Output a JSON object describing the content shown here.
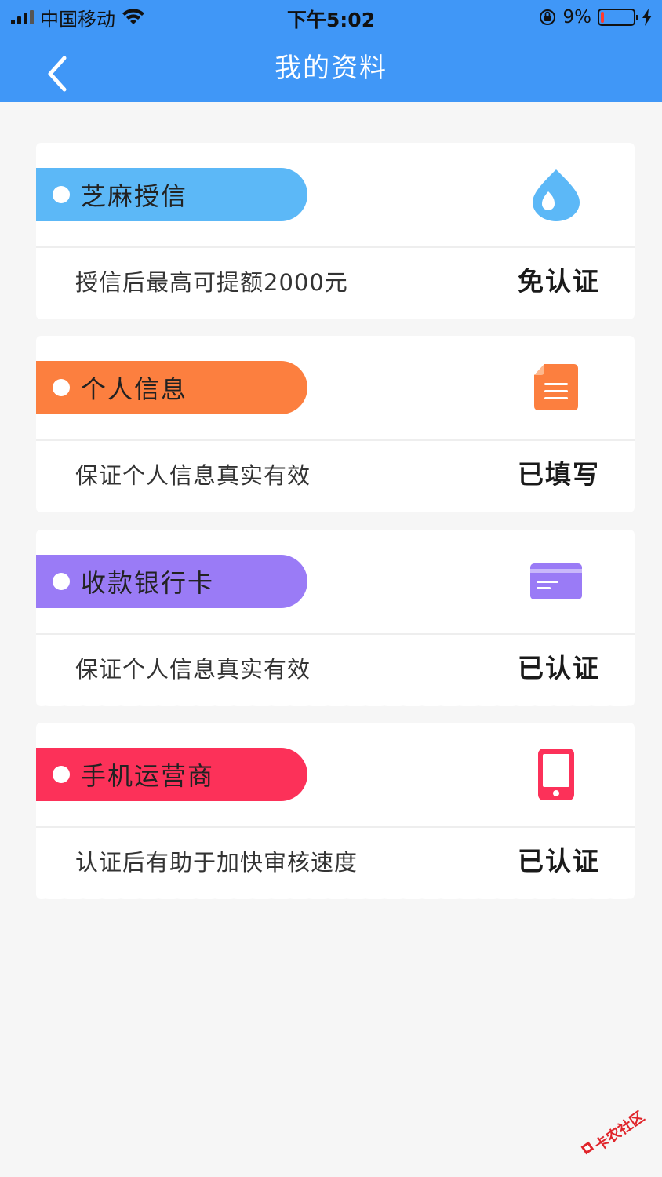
{
  "status_bar": {
    "carrier": "中国移动",
    "time": "下午5:02",
    "battery_percent": "9%",
    "battery_level": 0.09
  },
  "nav": {
    "title": "我的资料",
    "back_icon": "chevron-left-icon"
  },
  "cards": [
    {
      "label": "芝麻授信",
      "color": "#5cb8f7",
      "fold_color": "#2f86d6",
      "icon": "drop-icon",
      "icon_color": "#5cb8f7",
      "description": "授信后最高可提额2000元",
      "status": "免认证"
    },
    {
      "label": "个人信息",
      "color": "#fc7f3f",
      "fold_color": "#c35314",
      "icon": "document-icon",
      "icon_color": "#fc7f3f",
      "description": "保证个人信息真实有效",
      "status": "已填写"
    },
    {
      "label": "收款银行卡",
      "color": "#9a7bf6",
      "fold_color": "#5a3fd0",
      "icon": "bank-card-icon",
      "icon_color": "#9a7bf6",
      "description": "保证个人信息真实有效",
      "status": "已认证"
    },
    {
      "label": "手机运营商",
      "color": "#fc3159",
      "fold_color": "#b07a1f",
      "icon": "mobile-phone-icon",
      "icon_color": "#fc3159",
      "description": "认证后有助于加快审核速度",
      "status": "已认证"
    }
  ],
  "watermark": {
    "text": "卡农社区"
  }
}
